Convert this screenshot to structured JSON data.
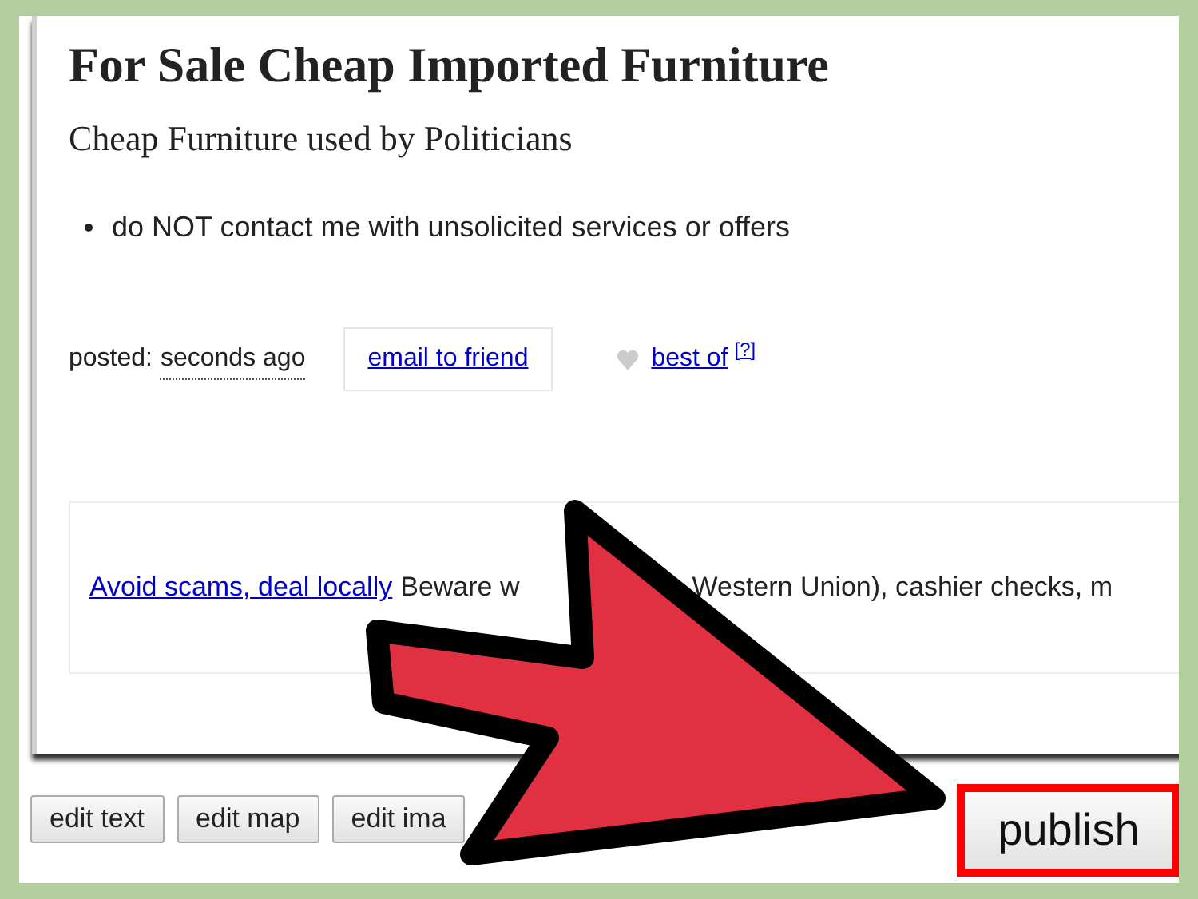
{
  "posting": {
    "title": "For Sale Cheap Imported Furniture",
    "subtitle": "Cheap Furniture used by Politicians",
    "bullets": [
      "do NOT contact me with unsolicited services or offers"
    ],
    "posted_label": "posted:",
    "posted_time": "seconds ago",
    "email_link": "email to friend",
    "best_of_link": "best of",
    "best_of_note": "[?]",
    "notice": {
      "link": "Avoid scams, deal locally",
      "text_before": "Beware w",
      "text_after": "Western Union), cashier checks, m"
    }
  },
  "buttons": [
    {
      "label": "edit text",
      "highlighted": false
    },
    {
      "label": "edit map",
      "highlighted": false
    },
    {
      "label": "edit ima",
      "highlighted": false
    },
    {
      "label": "publish",
      "highlighted": true
    }
  ]
}
